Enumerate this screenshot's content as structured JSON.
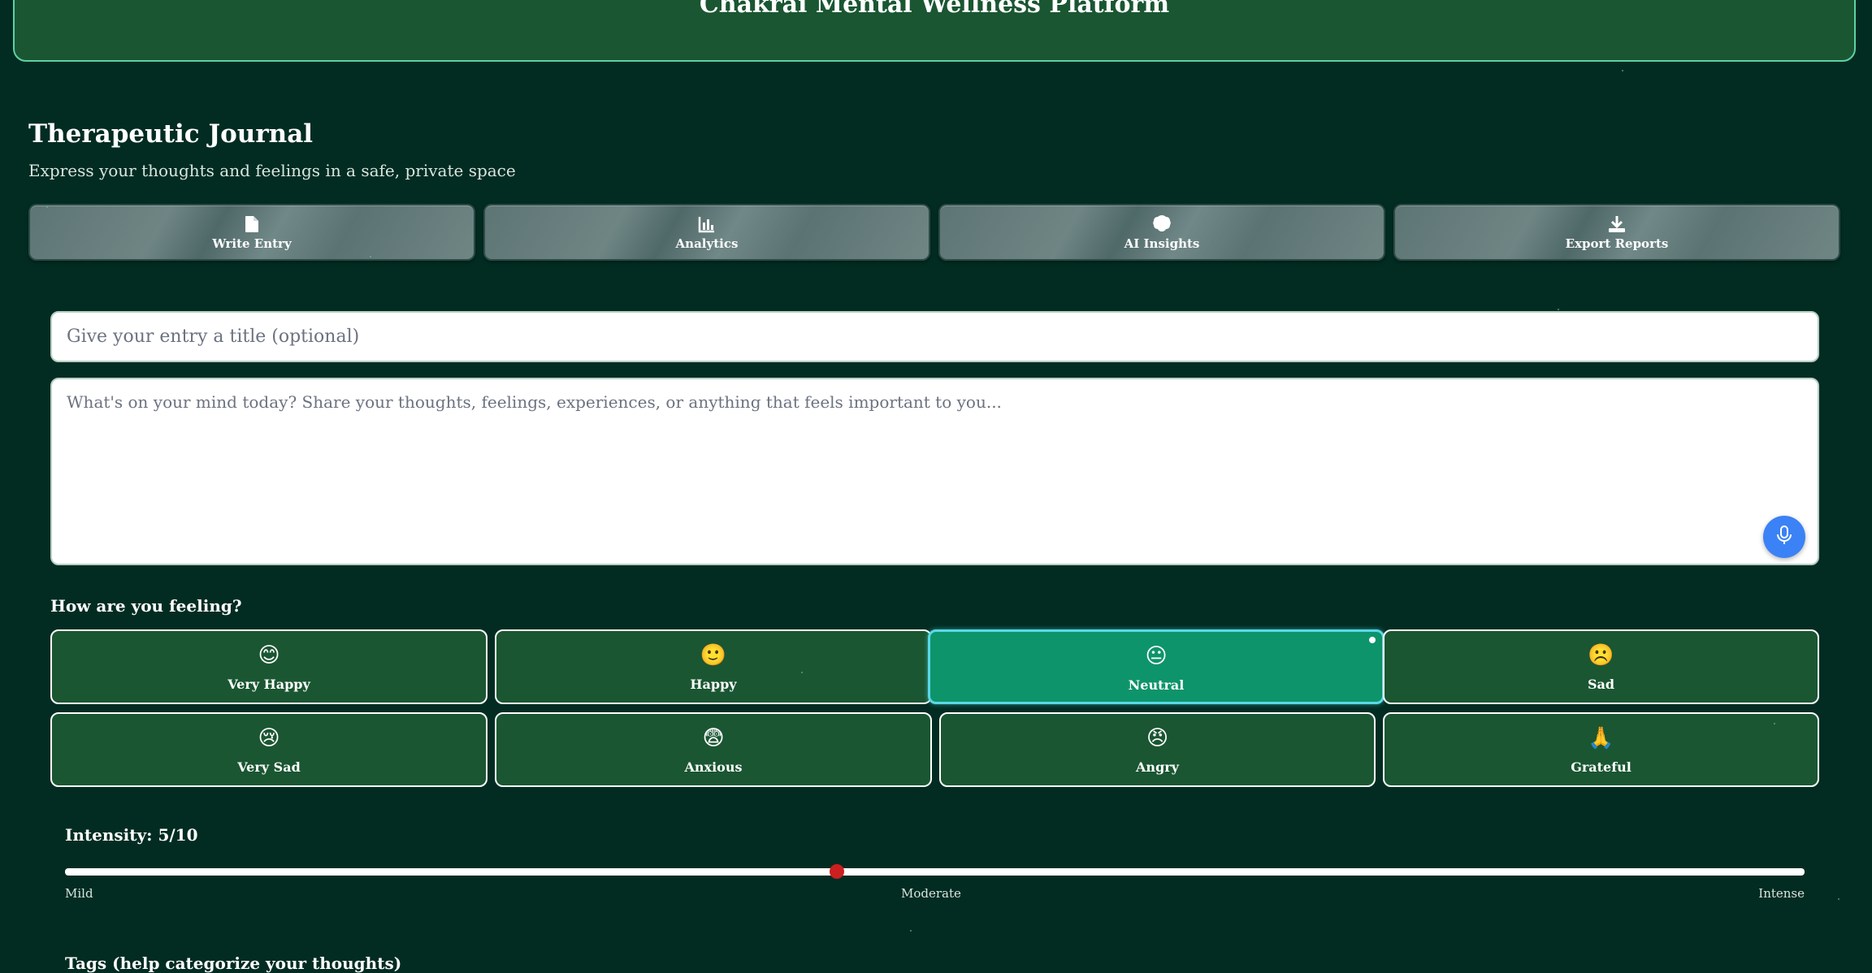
{
  "header": {
    "title": "Chakrai Mental Wellness Platform"
  },
  "journal": {
    "title": "Therapeutic Journal",
    "subtitle": "Express your thoughts and feelings in a safe, private space"
  },
  "tabs": [
    {
      "label": "Write Entry",
      "icon": "document-icon"
    },
    {
      "label": "Analytics",
      "icon": "chart-icon"
    },
    {
      "label": "AI Insights",
      "icon": "brain-icon"
    },
    {
      "label": "Export Reports",
      "icon": "download-icon"
    }
  ],
  "entry": {
    "title_placeholder": "Give your entry a title (optional)",
    "title_value": "",
    "body_placeholder": "What's on your mind today? Share your thoughts, feelings, experiences, or anything that feels important to you...",
    "body_value": "",
    "mic_icon": "microphone-icon"
  },
  "feelings": {
    "label": "How are you feeling?",
    "selected": "Neutral",
    "moods": [
      {
        "label": "Very Happy",
        "emoji": "😊"
      },
      {
        "label": "Happy",
        "emoji": "🙂"
      },
      {
        "label": "Neutral",
        "emoji": "😐"
      },
      {
        "label": "Sad",
        "emoji": "☹️"
      },
      {
        "label": "Very Sad",
        "emoji": "😢"
      },
      {
        "label": "Anxious",
        "emoji": "😨"
      },
      {
        "label": "Angry",
        "emoji": "😠"
      },
      {
        "label": "Grateful",
        "emoji": "🙏"
      }
    ]
  },
  "intensity": {
    "label": "Intensity: 5/10",
    "value": 5,
    "min": 1,
    "max": 10,
    "scale": {
      "low": "Mild",
      "mid": "Moderate",
      "high": "Intense"
    }
  },
  "tags": {
    "label": "Tags (help categorize your thoughts)"
  },
  "colors": {
    "background": "#022c22",
    "header": "#1a5632",
    "mood_card": "#1a5632",
    "mood_selected": "#0e946a",
    "mic_button": "#3b82f6",
    "slider_thumb": "#cc1f1f"
  }
}
